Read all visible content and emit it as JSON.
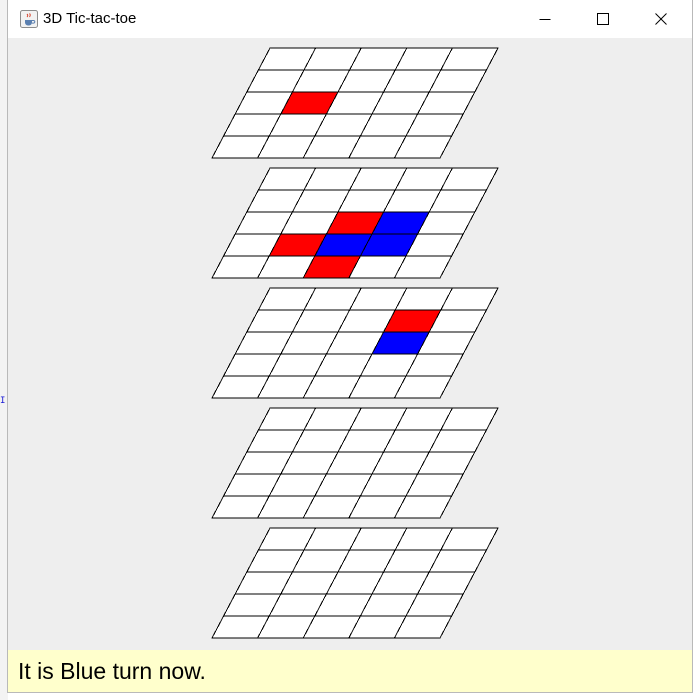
{
  "window": {
    "title": "3D Tic-tac-toe",
    "icon": "java-cup-icon"
  },
  "stray_text": "I",
  "status": {
    "text": "It is Blue turn now."
  },
  "game": {
    "grid_size": 5,
    "colors": {
      "red": "#ff0000",
      "blue": "#0000ff",
      "empty": "#ffffff",
      "line": "#000000",
      "background": "#eeeeee",
      "status_background": "#ffffcc"
    },
    "boards": [
      {
        "level": 1,
        "cells": [
          [
            0,
            0,
            0,
            0,
            0
          ],
          [
            0,
            0,
            0,
            0,
            0
          ],
          [
            0,
            1,
            0,
            0,
            0
          ],
          [
            0,
            0,
            0,
            0,
            0
          ],
          [
            0,
            0,
            0,
            0,
            0
          ]
        ]
      },
      {
        "level": 2,
        "cells": [
          [
            0,
            0,
            0,
            0,
            0
          ],
          [
            0,
            0,
            0,
            0,
            0
          ],
          [
            0,
            0,
            1,
            2,
            0
          ],
          [
            0,
            1,
            2,
            2,
            0
          ],
          [
            0,
            0,
            1,
            0,
            0
          ]
        ]
      },
      {
        "level": 3,
        "cells": [
          [
            0,
            0,
            0,
            0,
            0
          ],
          [
            0,
            0,
            0,
            1,
            0
          ],
          [
            0,
            0,
            0,
            2,
            0
          ],
          [
            0,
            0,
            0,
            0,
            0
          ],
          [
            0,
            0,
            0,
            0,
            0
          ]
        ]
      },
      {
        "level": 4,
        "cells": [
          [
            0,
            0,
            0,
            0,
            0
          ],
          [
            0,
            0,
            0,
            0,
            0
          ],
          [
            0,
            0,
            0,
            0,
            0
          ],
          [
            0,
            0,
            0,
            0,
            0
          ],
          [
            0,
            0,
            0,
            0,
            0
          ]
        ]
      },
      {
        "level": 5,
        "cells": [
          [
            0,
            0,
            0,
            0,
            0
          ],
          [
            0,
            0,
            0,
            0,
            0
          ],
          [
            0,
            0,
            0,
            0,
            0
          ],
          [
            0,
            0,
            0,
            0,
            0
          ],
          [
            0,
            0,
            0,
            0,
            0
          ]
        ]
      }
    ]
  }
}
